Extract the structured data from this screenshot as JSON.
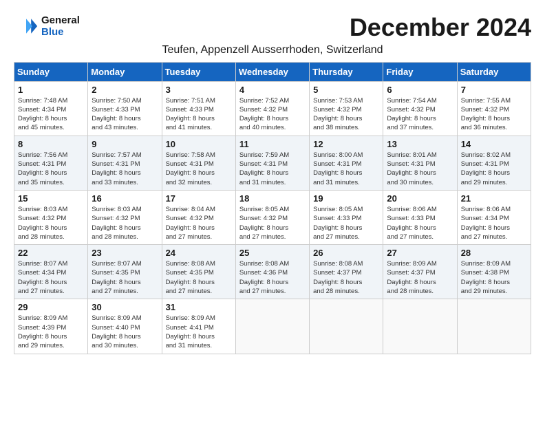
{
  "header": {
    "logo_line1": "General",
    "logo_line2": "Blue",
    "month_year": "December 2024",
    "location": "Teufen, Appenzell Ausserrhoden, Switzerland"
  },
  "weekdays": [
    "Sunday",
    "Monday",
    "Tuesday",
    "Wednesday",
    "Thursday",
    "Friday",
    "Saturday"
  ],
  "weeks": [
    [
      {
        "day": "1",
        "info": "Sunrise: 7:48 AM\nSunset: 4:34 PM\nDaylight: 8 hours\nand 45 minutes."
      },
      {
        "day": "2",
        "info": "Sunrise: 7:50 AM\nSunset: 4:33 PM\nDaylight: 8 hours\nand 43 minutes."
      },
      {
        "day": "3",
        "info": "Sunrise: 7:51 AM\nSunset: 4:33 PM\nDaylight: 8 hours\nand 41 minutes."
      },
      {
        "day": "4",
        "info": "Sunrise: 7:52 AM\nSunset: 4:32 PM\nDaylight: 8 hours\nand 40 minutes."
      },
      {
        "day": "5",
        "info": "Sunrise: 7:53 AM\nSunset: 4:32 PM\nDaylight: 8 hours\nand 38 minutes."
      },
      {
        "day": "6",
        "info": "Sunrise: 7:54 AM\nSunset: 4:32 PM\nDaylight: 8 hours\nand 37 minutes."
      },
      {
        "day": "7",
        "info": "Sunrise: 7:55 AM\nSunset: 4:32 PM\nDaylight: 8 hours\nand 36 minutes."
      }
    ],
    [
      {
        "day": "8",
        "info": "Sunrise: 7:56 AM\nSunset: 4:31 PM\nDaylight: 8 hours\nand 35 minutes."
      },
      {
        "day": "9",
        "info": "Sunrise: 7:57 AM\nSunset: 4:31 PM\nDaylight: 8 hours\nand 33 minutes."
      },
      {
        "day": "10",
        "info": "Sunrise: 7:58 AM\nSunset: 4:31 PM\nDaylight: 8 hours\nand 32 minutes."
      },
      {
        "day": "11",
        "info": "Sunrise: 7:59 AM\nSunset: 4:31 PM\nDaylight: 8 hours\nand 31 minutes."
      },
      {
        "day": "12",
        "info": "Sunrise: 8:00 AM\nSunset: 4:31 PM\nDaylight: 8 hours\nand 31 minutes."
      },
      {
        "day": "13",
        "info": "Sunrise: 8:01 AM\nSunset: 4:31 PM\nDaylight: 8 hours\nand 30 minutes."
      },
      {
        "day": "14",
        "info": "Sunrise: 8:02 AM\nSunset: 4:31 PM\nDaylight: 8 hours\nand 29 minutes."
      }
    ],
    [
      {
        "day": "15",
        "info": "Sunrise: 8:03 AM\nSunset: 4:32 PM\nDaylight: 8 hours\nand 28 minutes."
      },
      {
        "day": "16",
        "info": "Sunrise: 8:03 AM\nSunset: 4:32 PM\nDaylight: 8 hours\nand 28 minutes."
      },
      {
        "day": "17",
        "info": "Sunrise: 8:04 AM\nSunset: 4:32 PM\nDaylight: 8 hours\nand 27 minutes."
      },
      {
        "day": "18",
        "info": "Sunrise: 8:05 AM\nSunset: 4:32 PM\nDaylight: 8 hours\nand 27 minutes."
      },
      {
        "day": "19",
        "info": "Sunrise: 8:05 AM\nSunset: 4:33 PM\nDaylight: 8 hours\nand 27 minutes."
      },
      {
        "day": "20",
        "info": "Sunrise: 8:06 AM\nSunset: 4:33 PM\nDaylight: 8 hours\nand 27 minutes."
      },
      {
        "day": "21",
        "info": "Sunrise: 8:06 AM\nSunset: 4:34 PM\nDaylight: 8 hours\nand 27 minutes."
      }
    ],
    [
      {
        "day": "22",
        "info": "Sunrise: 8:07 AM\nSunset: 4:34 PM\nDaylight: 8 hours\nand 27 minutes."
      },
      {
        "day": "23",
        "info": "Sunrise: 8:07 AM\nSunset: 4:35 PM\nDaylight: 8 hours\nand 27 minutes."
      },
      {
        "day": "24",
        "info": "Sunrise: 8:08 AM\nSunset: 4:35 PM\nDaylight: 8 hours\nand 27 minutes."
      },
      {
        "day": "25",
        "info": "Sunrise: 8:08 AM\nSunset: 4:36 PM\nDaylight: 8 hours\nand 27 minutes."
      },
      {
        "day": "26",
        "info": "Sunrise: 8:08 AM\nSunset: 4:37 PM\nDaylight: 8 hours\nand 28 minutes."
      },
      {
        "day": "27",
        "info": "Sunrise: 8:09 AM\nSunset: 4:37 PM\nDaylight: 8 hours\nand 28 minutes."
      },
      {
        "day": "28",
        "info": "Sunrise: 8:09 AM\nSunset: 4:38 PM\nDaylight: 8 hours\nand 29 minutes."
      }
    ],
    [
      {
        "day": "29",
        "info": "Sunrise: 8:09 AM\nSunset: 4:39 PM\nDaylight: 8 hours\nand 29 minutes."
      },
      {
        "day": "30",
        "info": "Sunrise: 8:09 AM\nSunset: 4:40 PM\nDaylight: 8 hours\nand 30 minutes."
      },
      {
        "day": "31",
        "info": "Sunrise: 8:09 AM\nSunset: 4:41 PM\nDaylight: 8 hours\nand 31 minutes."
      },
      {
        "day": "",
        "info": ""
      },
      {
        "day": "",
        "info": ""
      },
      {
        "day": "",
        "info": ""
      },
      {
        "day": "",
        "info": ""
      }
    ]
  ]
}
